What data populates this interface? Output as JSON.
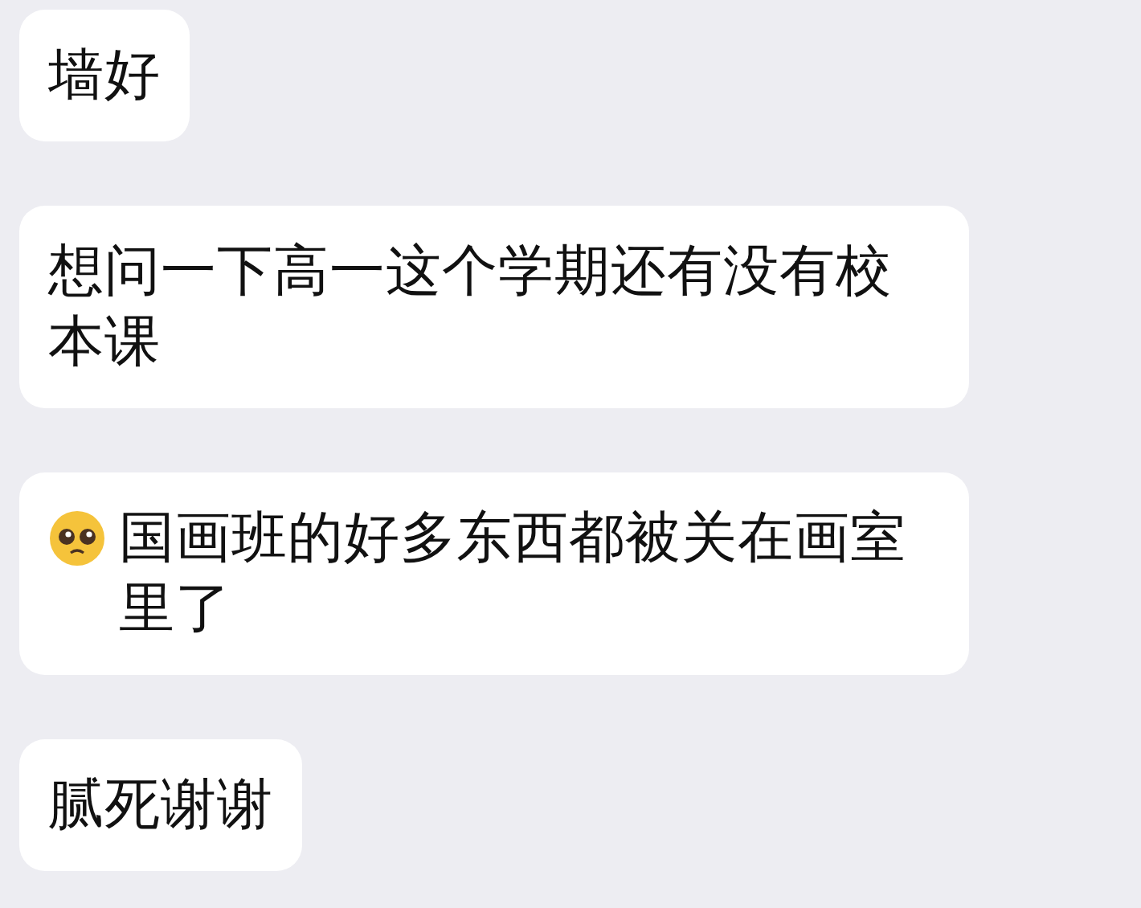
{
  "messages": [
    {
      "kind": "text",
      "text": "墙好"
    },
    {
      "kind": "text",
      "text": "想问一下高一这个学期还有没有校本课"
    },
    {
      "kind": "emoji_text",
      "text": "国画班的好多东西都被关在画室里了"
    },
    {
      "kind": "text",
      "text": "腻死谢谢"
    }
  ]
}
